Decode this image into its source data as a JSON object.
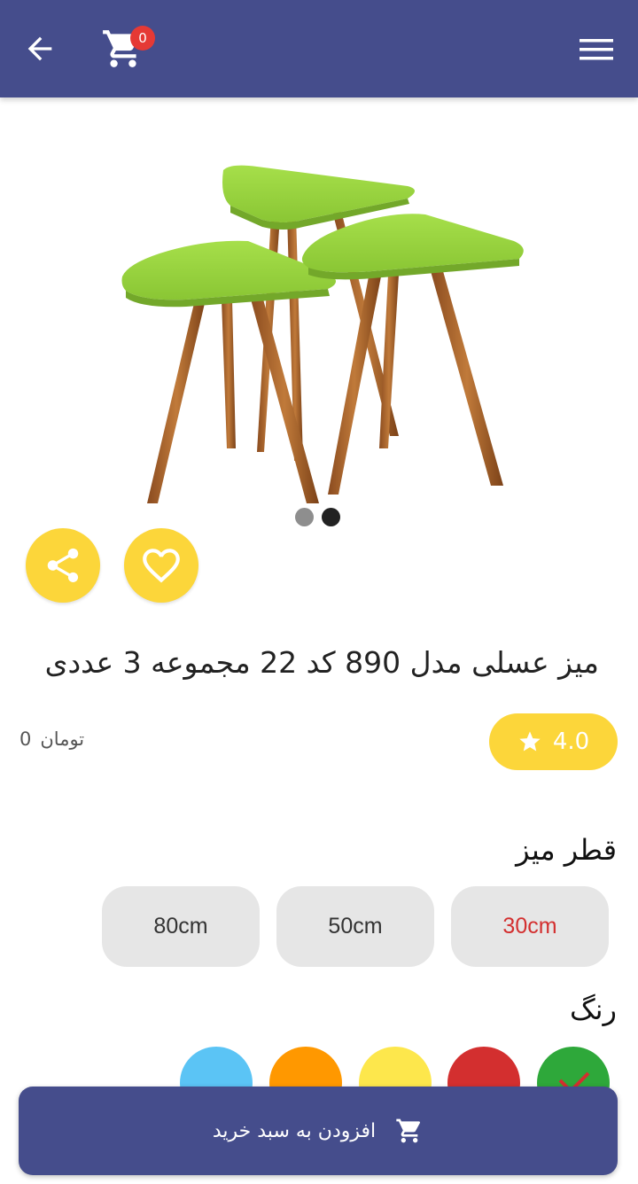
{
  "header": {
    "cart_count": "0",
    "bar_color": "#454d8c",
    "icons": [
      "arrow-left-icon",
      "cart-icon",
      "hamburger-menu-icon"
    ]
  },
  "gallery": {
    "image_alt": "",
    "dots": [
      {
        "state": "inactive",
        "color": "#8e8e8e"
      },
      {
        "state": "active",
        "color": "#222222"
      }
    ],
    "actions": [
      "share-icon",
      "heart-icon"
    ],
    "action_color": "#fcd63a"
  },
  "product": {
    "title": "میز عسلی مدل 890 کد 22 مجموعه 3 عددی",
    "rating": "4.0",
    "price_value": "0",
    "price_currency": "تومان"
  },
  "options": {
    "size_label": "قطر میز",
    "sizes": [
      {
        "label": "30cm",
        "selected": true
      },
      {
        "label": "50cm",
        "selected": false
      },
      {
        "label": "80cm",
        "selected": false
      }
    ],
    "selected_size_color": "#d32f2f",
    "color_label": "رنگ",
    "colors": [
      {
        "name": "green",
        "hex": "#2ea83a",
        "selected": true
      },
      {
        "name": "red",
        "hex": "#d32f2f",
        "selected": false
      },
      {
        "name": "yellow",
        "hex": "#fde74c",
        "selected": false
      },
      {
        "name": "orange",
        "hex": "#ff9800",
        "selected": false
      },
      {
        "name": "light-blue",
        "hex": "#5bc4f5",
        "selected": false
      }
    ]
  },
  "cta": {
    "add_to_cart_label": "افزودن به سبد خرید",
    "icon": "cart-icon"
  }
}
